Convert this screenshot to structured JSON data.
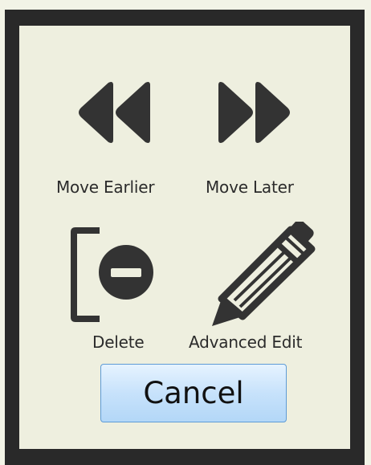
{
  "actions": {
    "move_earlier": {
      "label": "Move Earlier",
      "icon": "rewind-icon"
    },
    "move_later": {
      "label": "Move Later",
      "icon": "fast-forward-icon"
    },
    "delete": {
      "label": "Delete",
      "icon": "remove-item-icon"
    },
    "advanced_edit": {
      "label": "Advanced Edit",
      "icon": "pencil-icon"
    }
  },
  "cancel_label": "Cancel",
  "colors": {
    "frame": "#292929",
    "panel_bg": "#eeefdf",
    "icon": "#333333",
    "button_border": "#5e9bd6",
    "button_fill": "#c7e2fb"
  }
}
